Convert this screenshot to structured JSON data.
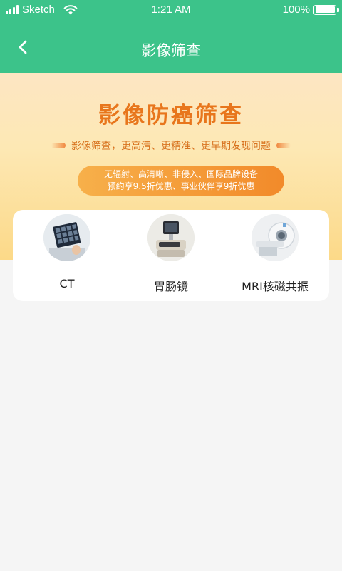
{
  "status_bar": {
    "carrier": "Sketch",
    "time": "1:21 AM",
    "battery": "100%",
    "battery_level": 1.0
  },
  "nav": {
    "title": "影像筛查",
    "back_icon": "chevron-left-icon"
  },
  "banner": {
    "title": "影像防癌筛查",
    "subtitle": "影像筛查，更高清、更精准、更早期发现问题",
    "pill_line1": "无辐射、高清晰、非侵入、国际品牌设备",
    "pill_line2": "预约享9.5折优惠、事业伙伴享9折优惠"
  },
  "categories": [
    {
      "label": "CT",
      "icon": "ct-scan-image"
    },
    {
      "label": "胃肠镜",
      "icon": "endoscope-image"
    },
    {
      "label": "MRI核磁共振",
      "icon": "mri-machine-image"
    }
  ],
  "colors": {
    "primary_green": "#3cc38a",
    "banner_orange": "#e8761c",
    "pill_orange": "#f28a2a"
  }
}
